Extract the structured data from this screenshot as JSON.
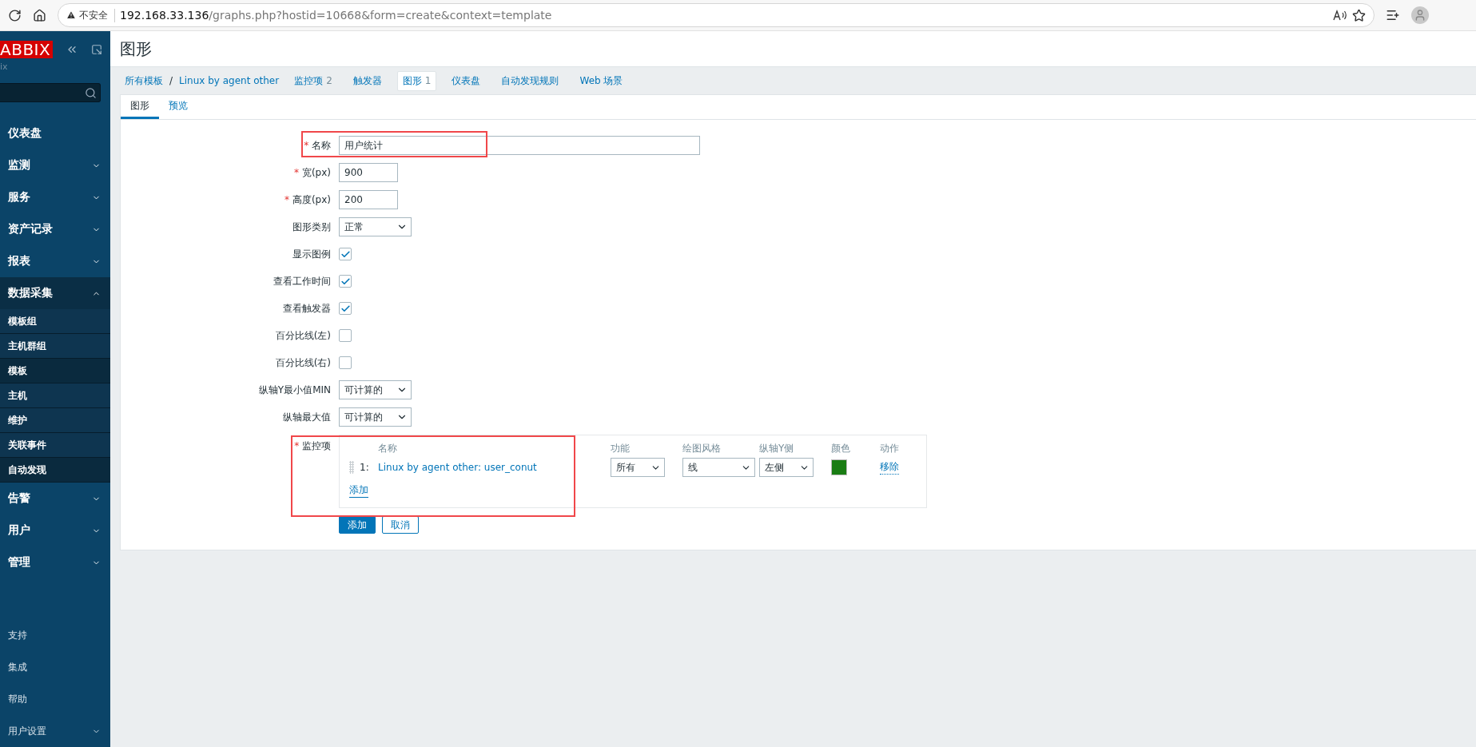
{
  "browser": {
    "insecure_label": "不安全",
    "url_host": "192.168.33.136",
    "url_path": "/graphs.php?hostid=10668&form=create&context=template"
  },
  "sidebar": {
    "logo": "ABBIX",
    "sublabel": "ix",
    "items": [
      {
        "label": "仪表盘",
        "expandable": false,
        "expanded": false
      },
      {
        "label": "监测",
        "expandable": true,
        "expanded": false
      },
      {
        "label": "服务",
        "expandable": true,
        "expanded": false
      },
      {
        "label": "资产记录",
        "expandable": true,
        "expanded": false
      },
      {
        "label": "报表",
        "expandable": true,
        "expanded": false
      },
      {
        "label": "数据采集",
        "expandable": true,
        "expanded": true,
        "children": [
          {
            "label": "模板组",
            "selected": false
          },
          {
            "label": "主机群组",
            "selected": false
          },
          {
            "label": "模板",
            "selected": true
          },
          {
            "label": "主机",
            "selected": false
          },
          {
            "label": "维护",
            "selected": false
          },
          {
            "label": "关联事件",
            "selected": false
          },
          {
            "label": "自动发现",
            "selected": true
          }
        ]
      },
      {
        "label": "告警",
        "expandable": true,
        "expanded": false
      },
      {
        "label": "用户",
        "expandable": true,
        "expanded": false
      },
      {
        "label": "管理",
        "expandable": true,
        "expanded": false
      }
    ],
    "footer_items": [
      {
        "label": "支持",
        "expandable": false
      },
      {
        "label": "集成",
        "expandable": false
      },
      {
        "label": "帮助",
        "expandable": false
      },
      {
        "label": "用户设置",
        "expandable": true
      }
    ]
  },
  "page": {
    "title": "图形"
  },
  "breadcrumb": {
    "root": "所有模板",
    "separator": "/",
    "host": "Linux by agent other"
  },
  "nav_tabs": [
    {
      "label": "监控项",
      "count": "2",
      "selected": false
    },
    {
      "label": "触发器",
      "selected": false
    },
    {
      "label": "图形",
      "count": "1",
      "selected": true
    },
    {
      "label": "仪表盘",
      "selected": false
    },
    {
      "label": "自动发现规则",
      "selected": false
    },
    {
      "label": "Web 场景",
      "selected": false
    }
  ],
  "form_tabs": [
    {
      "label": "图形",
      "selected": true
    },
    {
      "label": "预览",
      "selected": false
    }
  ],
  "form": {
    "fields": [
      {
        "kind": "text",
        "label": "名称",
        "required_mark": "*",
        "value": "用户统计",
        "wide": true,
        "highlighted": true
      },
      {
        "kind": "text",
        "label": "宽(px)",
        "required_mark": "*",
        "value": "900",
        "wide": false
      },
      {
        "kind": "text",
        "label": "高度(px)",
        "required_mark": "*",
        "value": "200",
        "wide": false
      },
      {
        "kind": "select",
        "label": "图形类别",
        "value": "正常"
      },
      {
        "kind": "checkbox",
        "label": "显示图例",
        "checked": true
      },
      {
        "kind": "checkbox",
        "label": "查看工作时间",
        "checked": true
      },
      {
        "kind": "checkbox",
        "label": "查看触发器",
        "checked": true
      },
      {
        "kind": "checkbox",
        "label": "百分比线(左)",
        "checked": false
      },
      {
        "kind": "checkbox",
        "label": "百分比线(右)",
        "checked": false
      },
      {
        "kind": "select",
        "label": "纵轴Y最小值MIN",
        "value": "可计算的"
      },
      {
        "kind": "select",
        "label": "纵轴最大值",
        "value": "可计算的"
      }
    ],
    "items": {
      "label": "监控项",
      "required_mark": "*",
      "highlighted": true,
      "columns": [
        "名称",
        "功能",
        "绘图风格",
        "纵轴Y侧",
        "颜色",
        "动作"
      ],
      "rows": [
        {
          "index": "1:",
          "name": "Linux by agent other: user_conut",
          "function": "所有",
          "draw_style": "线",
          "y_axis": "左侧",
          "color": "#1a7d14",
          "action": "移除"
        }
      ],
      "add_link": "添加"
    },
    "buttons": [
      {
        "label": "添加",
        "kind": "primary"
      },
      {
        "label": "取消",
        "kind": "secondary"
      }
    ]
  }
}
